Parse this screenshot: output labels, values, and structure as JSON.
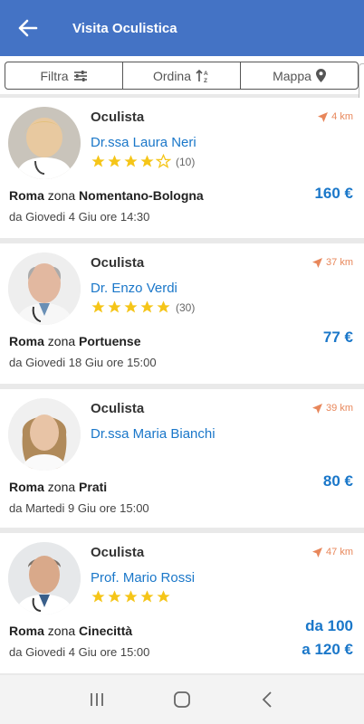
{
  "appbar": {
    "title": "Visita Oculistica",
    "back_icon": "arrow-left-icon",
    "color": "#4473c5"
  },
  "filters": {
    "filter_label": "Filtra",
    "sort_label": "Ordina",
    "map_label": "Mappa"
  },
  "results": [
    {
      "specialty": "Oculista",
      "doctor": "Dr.ssa Laura Neri",
      "rating": 4,
      "reviews": "(10)",
      "distance": "4 km",
      "city": "Roma",
      "zone_word": "zona",
      "zone": "Nomentano-Bologna",
      "availability": "da Giovedi 4 Giu ore 14:30",
      "price": "160 €"
    },
    {
      "specialty": "Oculista",
      "doctor": "Dr. Enzo Verdi",
      "rating": 5,
      "reviews": "(30)",
      "distance": "37 km",
      "city": "Roma",
      "zone_word": "zona",
      "zone": "Portuense",
      "availability": "da Giovedi 18 Giu ore 15:00",
      "price": "77 €"
    },
    {
      "specialty": "Oculista",
      "doctor": "Dr.ssa Maria Bianchi",
      "rating": 0,
      "reviews": "",
      "distance": "39 km",
      "city": "Roma",
      "zone_word": "zona",
      "zone": "Prati",
      "availability": "da Martedi 9 Giu ore 15:00",
      "price": "80 €"
    },
    {
      "specialty": "Oculista",
      "doctor": "Prof. Mario Rossi",
      "rating": 5,
      "reviews": "",
      "distance": "47 km",
      "city": "Roma",
      "zone_word": "zona",
      "zone": "Cinecittà",
      "availability": "da Giovedi 4 Giu ore 15:00",
      "price": "da 100",
      "price2": "a 120 €"
    }
  ],
  "colors": {
    "accent": "#1a77c9",
    "distance": "#e8875b",
    "star": "#f5c518"
  }
}
